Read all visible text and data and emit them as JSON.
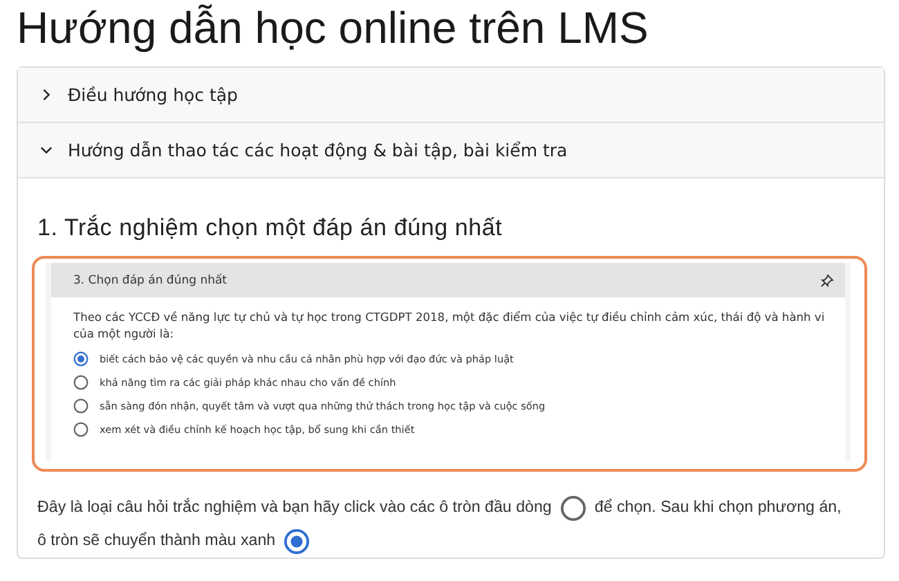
{
  "title": "Hướng dẫn học online trên LMS",
  "accordion": [
    {
      "label": "Điều hướng học tập",
      "expanded": false
    },
    {
      "label": "Hướng dẫn thao tác các hoạt động & bài tập, bài kiểm tra",
      "expanded": true
    }
  ],
  "section_heading": "1. Trắc nghiệm chọn một đáp án đúng nhất",
  "example": {
    "header": "3. Chọn đáp án đúng nhất",
    "question": "Theo các YCCĐ về năng lực tự chủ và tự học trong CTGDPT 2018, một đặc điểm của việc tự điều chỉnh cảm xúc, thái độ và hành vi của một người là:",
    "options": [
      {
        "label": "biết cách bảo vệ các quyền và nhu cầu cá nhân phù hợp với đạo đức và pháp luật",
        "selected": true
      },
      {
        "label": "khả năng tìm ra các giải pháp khác nhau cho vấn đề chính",
        "selected": false
      },
      {
        "label": "sẵn sàng đón nhận, quyết tâm và vượt qua những thử thách trong học tập và cuộc sống",
        "selected": false
      },
      {
        "label": "xem xét và điều chỉnh kế hoạch học tập, bổ sung khi cần thiết",
        "selected": false
      }
    ]
  },
  "instructions": [
    {
      "kind": "text",
      "text": "Đây là loại câu hỏi trắc nghiệm và bạn hãy click vào các ô tròn đầu dòng"
    },
    {
      "kind": "radio",
      "selected": false
    },
    {
      "kind": "text",
      "text": "để chọn. Sau khi chọn phương án,"
    },
    {
      "kind": "text",
      "text": "ô tròn sẽ chuyển thành màu xanh"
    },
    {
      "kind": "radio",
      "selected": true
    }
  ]
}
